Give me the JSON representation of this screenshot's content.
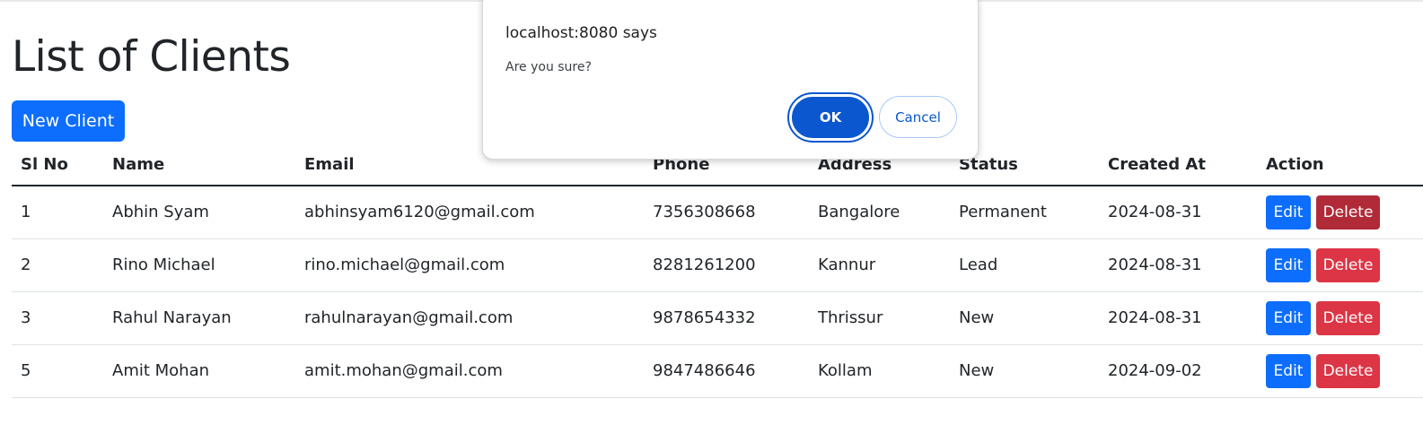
{
  "page": {
    "title": "List of Clients",
    "new_button_label": "New Client"
  },
  "table": {
    "headers": [
      "Sl No",
      "Name",
      "Email",
      "Phone",
      "Address",
      "Status",
      "Created At",
      "Action"
    ],
    "rows": [
      {
        "sl": "1",
        "name": "Abhin Syam",
        "email": "abhinsyam6120@gmail.com",
        "phone": "7356308668",
        "address": "Bangalore",
        "status": "Permanent",
        "created": "2024-08-31",
        "edit": "Edit",
        "delete": "Delete"
      },
      {
        "sl": "2",
        "name": "Rino Michael",
        "email": "rino.michael@gmail.com",
        "phone": "8281261200",
        "address": "Kannur",
        "status": "Lead",
        "created": "2024-08-31",
        "edit": "Edit",
        "delete": "Delete"
      },
      {
        "sl": "3",
        "name": "Rahul Narayan",
        "email": "rahulnarayan@gmail.com",
        "phone": "9878654332",
        "address": "Thrissur",
        "status": "New",
        "created": "2024-08-31",
        "edit": "Edit",
        "delete": "Delete"
      },
      {
        "sl": "5",
        "name": "Amit Mohan",
        "email": "amit.mohan@gmail.com",
        "phone": "9847486646",
        "address": "Kollam",
        "status": "New",
        "created": "2024-09-02",
        "edit": "Edit",
        "delete": "Delete"
      }
    ]
  },
  "dialog": {
    "title": "localhost:8080 says",
    "message": "Are you sure?",
    "ok_label": "OK",
    "cancel_label": "Cancel"
  },
  "colors": {
    "primary": "#0d6efd",
    "danger": "#dc3545",
    "danger_active": "#b02a37",
    "dialog_ok": "#0b57d0"
  }
}
